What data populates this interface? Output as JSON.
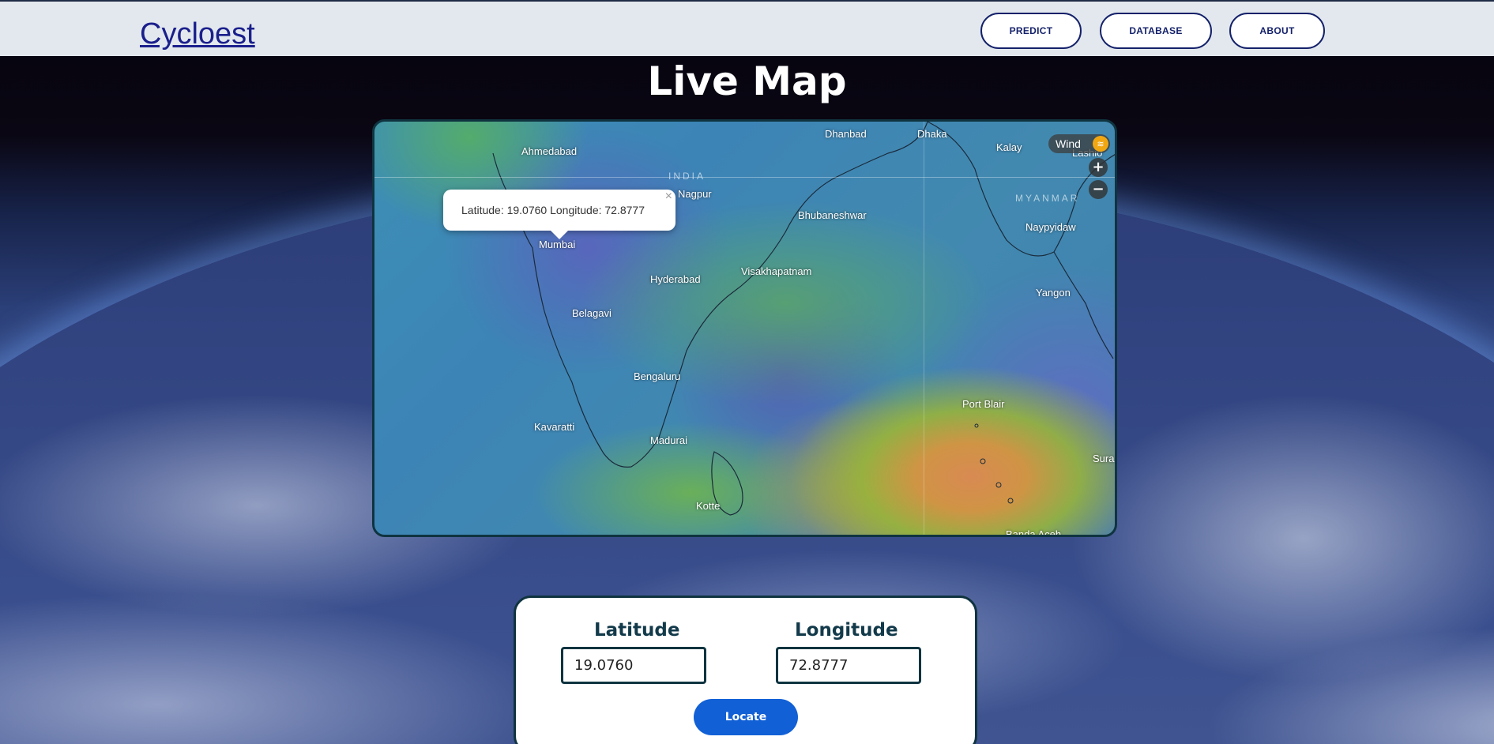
{
  "header": {
    "logo": "Cycloest",
    "nav": [
      {
        "label": "PREDICT"
      },
      {
        "label": "DATABASE"
      },
      {
        "label": "ABOUT"
      }
    ]
  },
  "page_title": "Live Map",
  "map": {
    "overlay_label": "Wind",
    "zoom_in": "+",
    "zoom_out": "−",
    "popup": {
      "text": "Latitude: 19.0760 Longitude: 72.8777",
      "close": "×"
    },
    "countries": [
      "INDIA",
      "MYANMAR"
    ],
    "cities": [
      "Ahmedabad",
      "Dhanbad",
      "Dhaka",
      "Kalay",
      "Lashio",
      "Nagpur",
      "Bhubaneshwar",
      "Naypyidaw",
      "Mumbai",
      "Hyderabad",
      "Visakhapatnam",
      "Yangon",
      "Belagavi",
      "Bengaluru",
      "Port Blair",
      "Kavaratti",
      "Madurai",
      "Sura",
      "Kotte",
      "Banda Aceh"
    ]
  },
  "form": {
    "latitude_label": "Latitude",
    "latitude_value": "19.0760",
    "longitude_label": "Longitude",
    "longitude_value": "72.8777",
    "locate_label": "Locate"
  }
}
